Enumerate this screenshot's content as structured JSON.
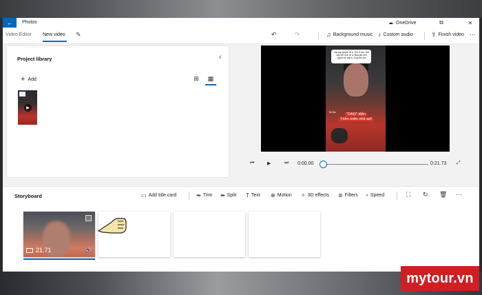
{
  "titlebar": {
    "app_name": "Photos",
    "onedrive_label": "OneDrive"
  },
  "commandbar": {
    "breadcrumb_root": "Video Editor",
    "breadcrumb_current": "New video",
    "background_music": "Background music",
    "custom_audio": "Custom audio",
    "finish_video": "Finish video"
  },
  "library": {
    "title": "Project library",
    "add_label": "Add"
  },
  "preview": {
    "overlay_bubble": "Lân tay Quỳnh đi ạ . Em ở tầu. Giờ này em mới về ạ. Bao giờ mọi người về vậy ạ. Giúp em với",
    "caption_line1": "\"DAO\" diễn",
    "caption_line2": "Triền miên nhé aef",
    "tiktok_label": "TikTok"
  },
  "playback": {
    "current_time": "0:00.00",
    "total_time": "0:21.73",
    "progress": 0
  },
  "storyboard": {
    "title": "Storyboard",
    "add_title_card": "Add title card",
    "trim": "Trim",
    "split": "Split",
    "text": "Text",
    "motion": "Motion",
    "effects_3d": "3D effects",
    "filters": "Filters",
    "speed": "Speed",
    "clip_duration": "21.71"
  },
  "watermark": "mytour.vn",
  "colors": {
    "accent": "#0067c0",
    "watermark_bg": "#cf1f23"
  }
}
